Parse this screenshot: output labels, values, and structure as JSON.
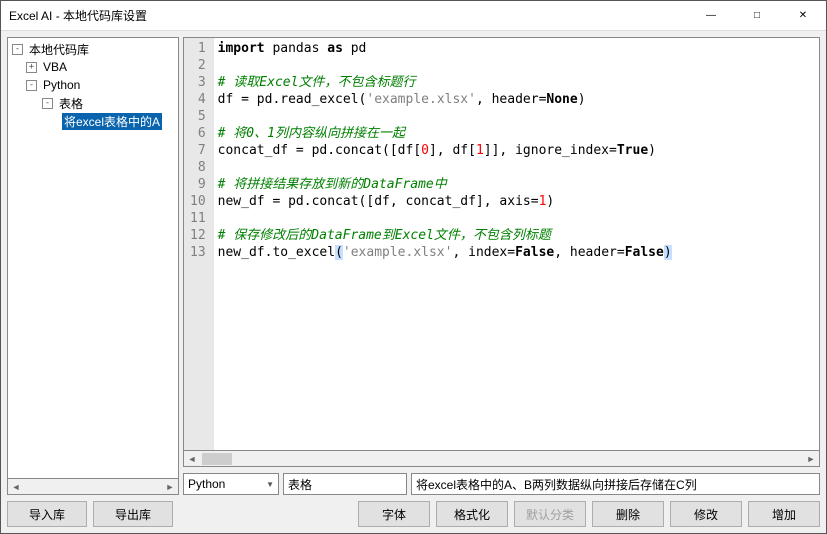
{
  "window": {
    "title": "Excel AI - 本地代码库设置"
  },
  "tree": {
    "root": "本地代码库",
    "items": {
      "vba": "VBA",
      "python": "Python",
      "tables": "表格",
      "selected": "将excel表格中的A"
    }
  },
  "code": {
    "lines": [
      {
        "n": 1,
        "segs": [
          {
            "t": "import ",
            "c": "kw"
          },
          {
            "t": "pandas "
          },
          {
            "t": "as ",
            "c": "kw"
          },
          {
            "t": "pd"
          }
        ]
      },
      {
        "n": 2,
        "segs": []
      },
      {
        "n": 3,
        "segs": [
          {
            "t": "# 读取Excel文件，不包含标题行",
            "c": "cmt"
          }
        ]
      },
      {
        "n": 4,
        "segs": [
          {
            "t": "df = pd.read_excel("
          },
          {
            "t": "'example.xlsx'",
            "c": "str"
          },
          {
            "t": ", header="
          },
          {
            "t": "None",
            "c": "const"
          },
          {
            "t": ")"
          }
        ]
      },
      {
        "n": 5,
        "segs": []
      },
      {
        "n": 6,
        "segs": [
          {
            "t": "# 将0、1列内容纵向拼接在一起",
            "c": "cmt"
          }
        ]
      },
      {
        "n": 7,
        "segs": [
          {
            "t": "concat_df = pd.concat([df["
          },
          {
            "t": "0",
            "c": "num"
          },
          {
            "t": "], df["
          },
          {
            "t": "1",
            "c": "num"
          },
          {
            "t": "]], ignore_index="
          },
          {
            "t": "True",
            "c": "const"
          },
          {
            "t": ")"
          }
        ]
      },
      {
        "n": 8,
        "segs": []
      },
      {
        "n": 9,
        "segs": [
          {
            "t": "# 将拼接结果存放到新的DataFrame中",
            "c": "cmt"
          }
        ]
      },
      {
        "n": 10,
        "segs": [
          {
            "t": "new_df = pd.concat([df, concat_df], axis="
          },
          {
            "t": "1",
            "c": "num"
          },
          {
            "t": ")"
          }
        ]
      },
      {
        "n": 11,
        "segs": []
      },
      {
        "n": 12,
        "segs": [
          {
            "t": "# 保存修改后的DataFrame到Excel文件，不包含列标题",
            "c": "cmt"
          }
        ]
      },
      {
        "n": 13,
        "segs": [
          {
            "t": "new_df.to_excel"
          },
          {
            "t": "(",
            "c": "paren-hl"
          },
          {
            "t": "'example.xlsx'",
            "c": "str"
          },
          {
            "t": ", index="
          },
          {
            "t": "False",
            "c": "const"
          },
          {
            "t": ", header="
          },
          {
            "t": "False",
            "c": "const"
          },
          {
            "t": ")",
            "c": "paren-hl"
          }
        ]
      }
    ]
  },
  "inputs": {
    "language": "Python",
    "category": "表格",
    "description": "将excel表格中的A、B两列数据纵向拼接后存储在C列"
  },
  "buttons": {
    "import": "导入库",
    "export": "导出库",
    "font": "字体",
    "format": "格式化",
    "defcat": "默认分类",
    "delete": "删除",
    "modify": "修改",
    "add": "增加"
  }
}
